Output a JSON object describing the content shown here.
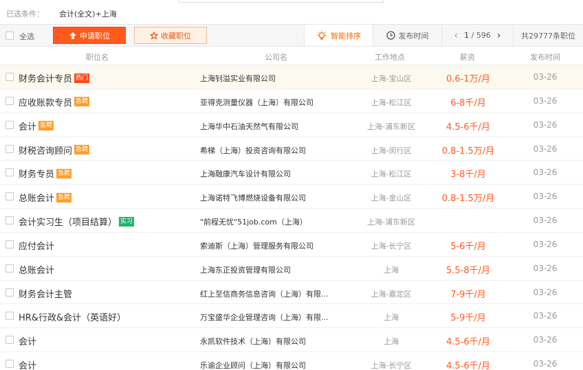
{
  "filter": {
    "label": "已选条件：",
    "value": "会计(全文)+上海"
  },
  "toolbar": {
    "select_all": "全选",
    "apply": "申请职位",
    "favorite": "收藏职位",
    "sort_smart": "智能排序",
    "sort_time": "发布时间",
    "page_current": "1",
    "page_total": "/ 596",
    "total": "共29777条职位"
  },
  "colors": {
    "accent": "#ff5a1c",
    "hot_tag": "#ff4a18",
    "urgent_tag": "#ff9d2e",
    "intern_tag": "#23b46c"
  },
  "header": {
    "title": "职位名",
    "company": "公司名",
    "location": "工作地点",
    "salary": "薪资",
    "date": "发布时间"
  },
  "rows": [
    {
      "title": "财务会计专员",
      "tag": "热门",
      "tag_type": "hot",
      "company": "上海钊溢实业有限公司",
      "location": "上海-宝山区",
      "salary": "0.6-1万/月",
      "date": "03-26"
    },
    {
      "title": "应收账款专员",
      "tag": "急聘",
      "tag_type": "urgent",
      "company": "亚得克测量仪器（上海）有限公司",
      "location": "上海-松江区",
      "salary": "6-8千/月",
      "date": "03-26"
    },
    {
      "title": "会计",
      "tag": "急聘",
      "tag_type": "urgent",
      "company": "上海华中石油天然气有限公司",
      "location": "上海-浦东新区",
      "salary": "4.5-6千/月",
      "date": "03-26"
    },
    {
      "title": "财税咨询顾问",
      "tag": "急聘",
      "tag_type": "urgent",
      "company": "希梯（上海）投资咨询有限公司",
      "location": "上海-闵行区",
      "salary": "0.8-1.5万/月",
      "date": "03-26"
    },
    {
      "title": "财务专员",
      "tag": "急聘",
      "tag_type": "urgent",
      "company": "上海融康汽车设计有限公司",
      "location": "上海-松江区",
      "salary": "3-8千/月",
      "date": "03-26"
    },
    {
      "title": "总账会计",
      "tag": "急聘",
      "tag_type": "urgent",
      "company": "上海诺特飞博燃烧设备有限公司",
      "location": "上海-金山区",
      "salary": "0.8-1.5万/月",
      "date": "03-26"
    },
    {
      "title": "会计实习生（项目结算）",
      "tag": "实习",
      "tag_type": "intern",
      "company": "\"前程无忧\"51job.com（上海）",
      "location": "上海-浦东新区",
      "salary": "",
      "date": "03-26"
    },
    {
      "title": "应付会计",
      "tag": "",
      "tag_type": "",
      "company": "索迪斯（上海）管理服务有限公司",
      "location": "上海-长宁区",
      "salary": "5-6千/月",
      "date": "03-26"
    },
    {
      "title": "总账会计",
      "tag": "",
      "tag_type": "",
      "company": "上海东正投资管理有限公司",
      "location": "上海",
      "salary": "5.5-8千/月",
      "date": "03-26"
    },
    {
      "title": "财务会计主管",
      "tag": "",
      "tag_type": "",
      "company": "红上至信商务信息咨询（上海）有限...",
      "location": "上海-嘉定区",
      "salary": "7-9千/月",
      "date": "03-26"
    },
    {
      "title": "HR&行政&会计（英语好）",
      "tag": "",
      "tag_type": "",
      "company": "万宝盛华企业管理咨询（上海）有限...",
      "location": "上海",
      "salary": "5-9千/月",
      "date": "03-26"
    },
    {
      "title": "会计",
      "tag": "",
      "tag_type": "",
      "company": "永凯软件技术（上海）有限公司",
      "location": "上海",
      "salary": "4.5-6千/月",
      "date": "03-26"
    },
    {
      "title": "会计",
      "tag": "",
      "tag_type": "",
      "company": "乐谕企业顾问（上海）有限公司",
      "location": "上海-长宁区",
      "salary": "4.5-6千/月",
      "date": "03-26"
    }
  ]
}
